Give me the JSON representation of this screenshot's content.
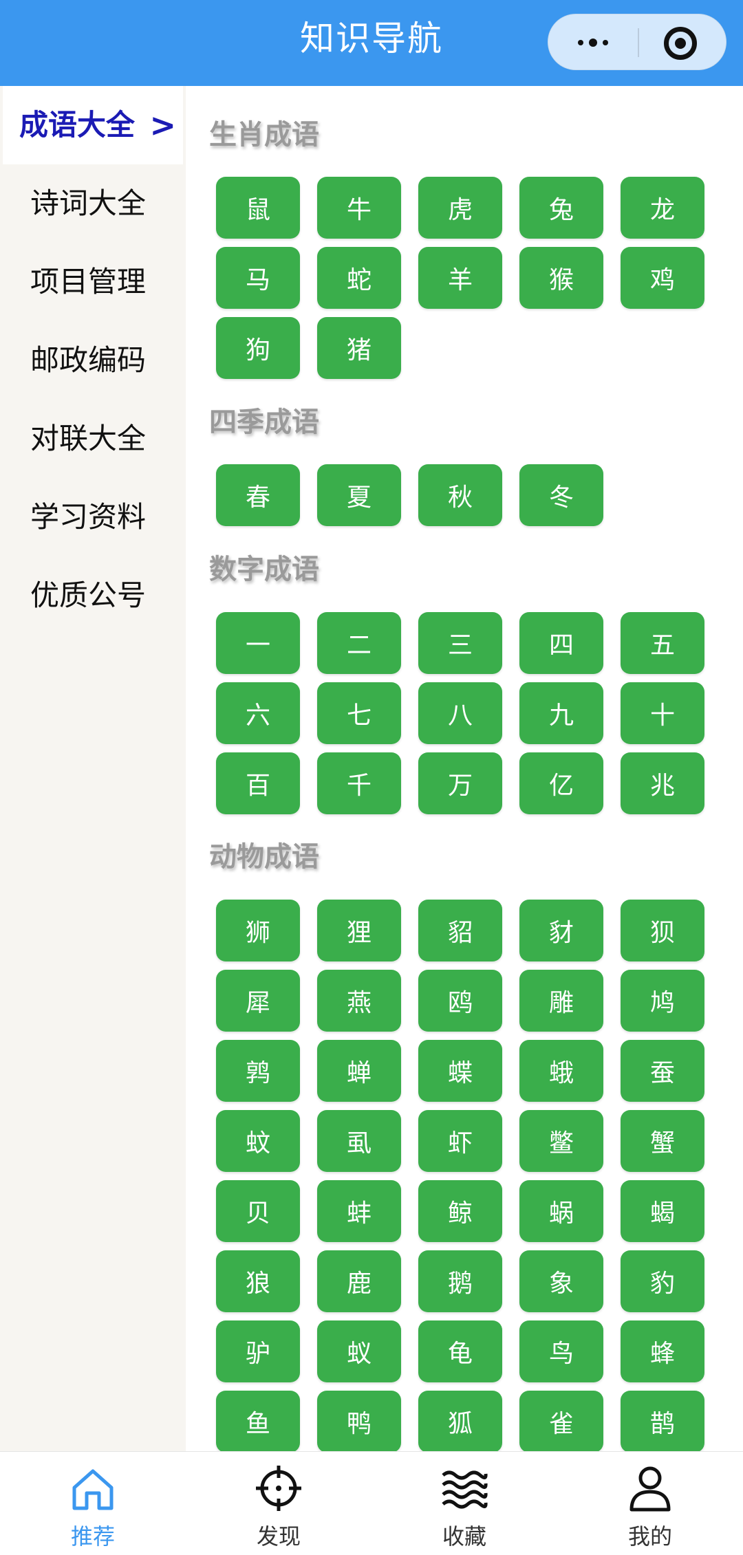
{
  "header": {
    "title": "知识导航"
  },
  "sidebar": {
    "items": [
      {
        "label": "成语大全",
        "active": true
      },
      {
        "label": "诗词大全"
      },
      {
        "label": "项目管理"
      },
      {
        "label": "邮政编码"
      },
      {
        "label": "对联大全"
      },
      {
        "label": "学习资料"
      },
      {
        "label": "优质公号"
      }
    ],
    "active_chevron": ">"
  },
  "sections": [
    {
      "title": "生肖成语",
      "items": [
        "鼠",
        "牛",
        "虎",
        "兔",
        "龙",
        "马",
        "蛇",
        "羊",
        "猴",
        "鸡",
        "狗",
        "猪"
      ]
    },
    {
      "title": "四季成语",
      "items": [
        "春",
        "夏",
        "秋",
        "冬"
      ]
    },
    {
      "title": "数字成语",
      "items": [
        "一",
        "二",
        "三",
        "四",
        "五",
        "六",
        "七",
        "八",
        "九",
        "十",
        "百",
        "千",
        "万",
        "亿",
        "兆"
      ]
    },
    {
      "title": "动物成语",
      "items": [
        "狮",
        "狸",
        "貂",
        "豺",
        "狈",
        "犀",
        "燕",
        "鸥",
        "雕",
        "鸠",
        "鹑",
        "蝉",
        "蝶",
        "蛾",
        "蚕",
        "蚊",
        "虱",
        "虾",
        "鳖",
        "蟹",
        "贝",
        "蚌",
        "鲸",
        "蜗",
        "蝎",
        "狼",
        "鹿",
        "鹅",
        "象",
        "豹",
        "驴",
        "蚁",
        "龟",
        "鸟",
        "蜂",
        "鱼",
        "鸭",
        "狐",
        "雀",
        "鹊"
      ]
    }
  ],
  "tabbar": {
    "tabs": [
      {
        "label": "推荐",
        "icon": "home-icon",
        "active": true
      },
      {
        "label": "发现",
        "icon": "crosshair-icon"
      },
      {
        "label": "收藏",
        "icon": "waves-icon"
      },
      {
        "label": "我的",
        "icon": "user-icon"
      }
    ]
  },
  "colors": {
    "header": "#3b97ef",
    "chip": "#3aae4b",
    "active_tab": "#3b97ef",
    "active_sidebar": "#1b1bb4"
  }
}
